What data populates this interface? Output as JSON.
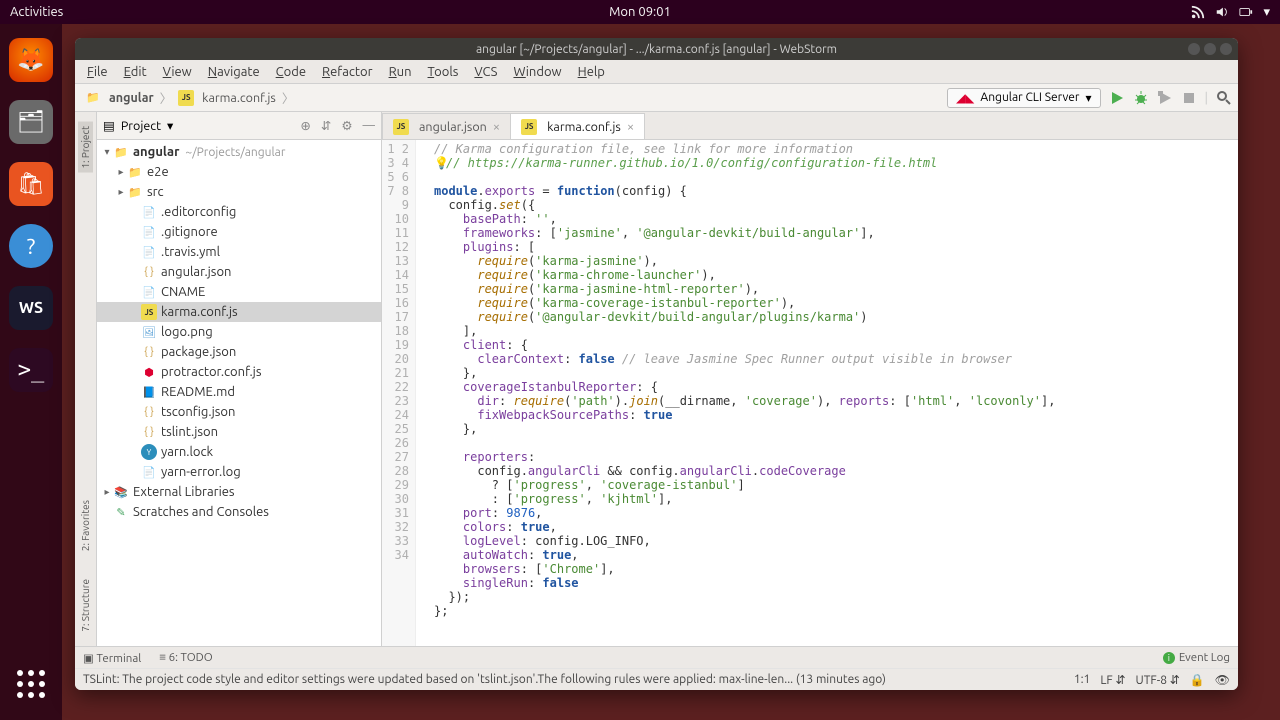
{
  "topbar": {
    "activities": "Activities",
    "clock": "Mon 09:01"
  },
  "ide": {
    "title": "angular [~/Projects/angular] - .../karma.conf.js [angular] - WebStorm",
    "menu": [
      "File",
      "Edit",
      "View",
      "Navigate",
      "Code",
      "Refactor",
      "Run",
      "Tools",
      "VCS",
      "Window",
      "Help"
    ],
    "breadcrumb": {
      "root": "angular",
      "file": "karma.conf.js"
    },
    "runcfg": "Angular CLI Server",
    "sidetabs": {
      "project": "1: Project",
      "favorites": "2: Favorites",
      "structure": "7: Structure"
    },
    "project_header": "Project",
    "tree": {
      "root": {
        "name": "angular",
        "path": "~/Projects/angular"
      },
      "dirs": [
        "e2e",
        "src"
      ],
      "files": [
        {
          "n": ".editorconfig",
          "ico": "txt"
        },
        {
          "n": ".gitignore",
          "ico": "txt"
        },
        {
          "n": ".travis.yml",
          "ico": "txt"
        },
        {
          "n": "angular.json",
          "ico": "json"
        },
        {
          "n": "CNAME",
          "ico": "txt"
        },
        {
          "n": "karma.conf.js",
          "ico": "js",
          "sel": true
        },
        {
          "n": "logo.png",
          "ico": "img"
        },
        {
          "n": "package.json",
          "ico": "json"
        },
        {
          "n": "protractor.conf.js",
          "ico": "ng"
        },
        {
          "n": "README.md",
          "ico": "md"
        },
        {
          "n": "tsconfig.json",
          "ico": "json"
        },
        {
          "n": "tslint.json",
          "ico": "json"
        },
        {
          "n": "yarn.lock",
          "ico": "yarn"
        },
        {
          "n": "yarn-error.log",
          "ico": "txt"
        }
      ],
      "extra": [
        "External Libraries",
        "Scratches and Consoles"
      ]
    },
    "tabs": [
      {
        "label": "angular.json",
        "active": false
      },
      {
        "label": "karma.conf.js",
        "active": true
      }
    ],
    "code_lines": [
      {
        "t": "// Karma configuration file, see link for more information",
        "cls": "c-cmt"
      },
      {
        "t": "// https://karma-runner.github.io/1.0/config/configuration-file.html",
        "cls": "c-link",
        "bulb": true
      },
      {
        "t": ""
      },
      {
        "raw": "<span class='c-kw'>module</span>.<span class='c-prop'>exports</span> = <span class='c-kw'>function</span>(config) {"
      },
      {
        "raw": "  config.<span class='c-fn'>set</span>({"
      },
      {
        "raw": "    <span class='c-prop'>basePath</span>: <span class='c-str'>''</span>,"
      },
      {
        "raw": "    <span class='c-prop'>frameworks</span>: [<span class='c-str'>'jasmine'</span>, <span class='c-str'>'@angular-devkit/build-angular'</span>],"
      },
      {
        "raw": "    <span class='c-prop'>plugins</span>: ["
      },
      {
        "raw": "      <span class='c-fn'>require</span>(<span class='c-str'>'karma-jasmine'</span>),"
      },
      {
        "raw": "      <span class='c-fn'>require</span>(<span class='c-str'>'karma-chrome-launcher'</span>),"
      },
      {
        "raw": "      <span class='c-fn'>require</span>(<span class='c-str'>'karma-jasmine-html-reporter'</span>),"
      },
      {
        "raw": "      <span class='c-fn'>require</span>(<span class='c-str'>'karma-coverage-istanbul-reporter'</span>),"
      },
      {
        "raw": "      <span class='c-fn'>require</span>(<span class='c-str'>'@angular-devkit/build-angular/plugins/karma'</span>)"
      },
      {
        "raw": "    ],"
      },
      {
        "raw": "    <span class='c-prop'>client</span>: {"
      },
      {
        "raw": "      <span class='c-prop'>clearContext</span>: <span class='c-bool'>false</span> <span class='c-cmt'>// leave Jasmine Spec Runner output visible in browser</span>"
      },
      {
        "raw": "    },"
      },
      {
        "raw": "    <span class='c-prop'>coverageIstanbulReporter</span>: {"
      },
      {
        "raw": "      <span class='c-prop'>dir</span>: <span class='c-fn'>require</span>(<span class='c-str'>'path'</span>).<span class='c-fn'>join</span>(__dirname, <span class='c-str'>'coverage'</span>), <span class='c-prop'>reports</span>: [<span class='c-str'>'html'</span>, <span class='c-str'>'lcovonly'</span>],"
      },
      {
        "raw": "      <span class='c-prop'>fixWebpackSourcePaths</span>: <span class='c-bool'>true</span>"
      },
      {
        "raw": "    },"
      },
      {
        "raw": ""
      },
      {
        "raw": "    <span class='c-prop'>reporters</span>:"
      },
      {
        "raw": "      config.<span class='c-prop'>angularCli</span> && config.<span class='c-prop'>angularCli</span>.<span class='c-prop'>codeCoverage</span>"
      },
      {
        "raw": "        ? [<span class='c-str'>'progress'</span>, <span class='c-str'>'coverage-istanbul'</span>]"
      },
      {
        "raw": "        : [<span class='c-str'>'progress'</span>, <span class='c-str'>'kjhtml'</span>],"
      },
      {
        "raw": "    <span class='c-prop'>port</span>: <span class='c-num'>9876</span>,"
      },
      {
        "raw": "    <span class='c-prop'>colors</span>: <span class='c-bool'>true</span>,"
      },
      {
        "raw": "    <span class='c-prop'>logLevel</span>: config.LOG_INFO,"
      },
      {
        "raw": "    <span class='c-prop'>autoWatch</span>: <span class='c-bool'>true</span>,"
      },
      {
        "raw": "    <span class='c-prop'>browsers</span>: [<span class='c-str'>'Chrome'</span>],"
      },
      {
        "raw": "    <span class='c-prop'>singleRun</span>: <span class='c-bool'>false</span>"
      },
      {
        "raw": "  });"
      },
      {
        "raw": "};"
      }
    ],
    "toolwin": {
      "terminal": "Terminal",
      "todo": "6: TODO",
      "eventlog": "Event Log"
    },
    "status": {
      "msg": "TSLint: The project code style and editor settings were updated based on 'tslint.json'.The following rules were applied: max-line-len... (13 minutes ago)",
      "pos": "1:1",
      "sep": "LF",
      "enc": "UTF-8"
    }
  }
}
